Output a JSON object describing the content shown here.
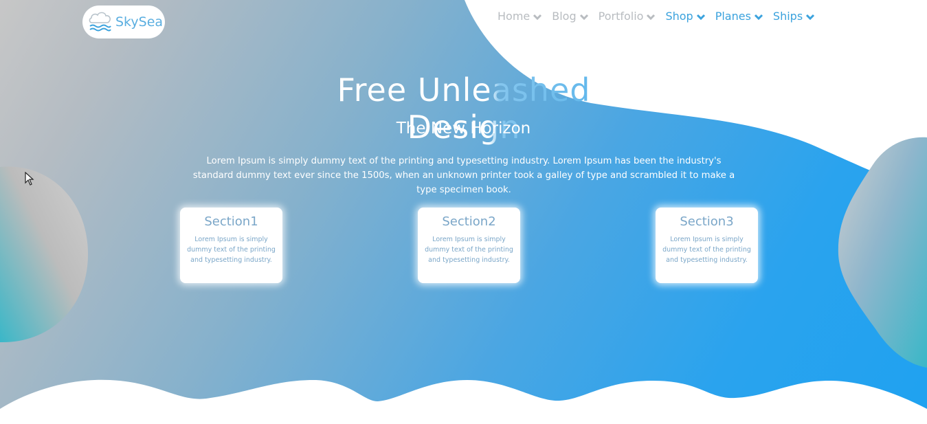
{
  "logo": {
    "text": "SkySea",
    "icon": "cloud-waves-icon"
  },
  "nav": {
    "items": [
      {
        "label": "Home",
        "icon": "chevron-down-icon"
      },
      {
        "label": "Blog",
        "icon": "chevron-down-icon"
      },
      {
        "label": "Portfolio",
        "icon": "chevron-down-icon"
      },
      {
        "label": "Shop",
        "icon": "chevron-down-icon"
      },
      {
        "label": "Planes",
        "icon": "chevron-down-icon"
      },
      {
        "label": "Ships",
        "icon": "chevron-down-icon"
      }
    ]
  },
  "hero": {
    "title": "Free Unleashed Design",
    "subtitle": "The New Horizon",
    "body": "Lorem Ipsum is simply dummy text of the printing and typesetting industry. Lorem Ipsum has been the industry's standard dummy text ever since the 1500s, when an unknown printer took a galley of type and scrambled it to make a type specimen book."
  },
  "sections": [
    {
      "title": "Section1",
      "text": "Lorem Ipsum is simply dummy text of the printing and typesetting industry."
    },
    {
      "title": "Section2",
      "text": "Lorem Ipsum is simply dummy text of the printing and typesetting industry."
    },
    {
      "title": "Section3",
      "text": "Lorem Ipsum is simply dummy text of the printing and typesetting industry."
    }
  ],
  "colors": {
    "accent": "#1fa2f0",
    "nav_grey": "#b8bcc0",
    "nav_blue": "#3aa2dd",
    "card_text": "#7aa6c8"
  }
}
